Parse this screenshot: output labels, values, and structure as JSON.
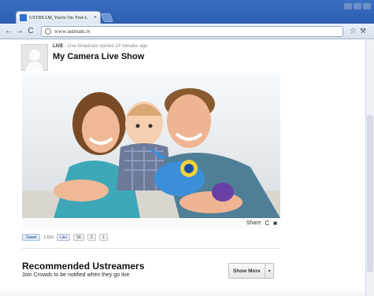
{
  "browser": {
    "tab_title": "USTREAM, You're On. Free L",
    "tab_close": "×",
    "url": "www.ustream.tv",
    "back": "←",
    "forward": "→",
    "reload": "C",
    "star": "☆",
    "wrench": "🔧"
  },
  "broadcast": {
    "live_tag": "LIVE",
    "live_status": " - Live broadcast started 24 minutes ago",
    "title": "My Camera Live Show"
  },
  "player": {
    "share_label": "Share",
    "reload_icon": "C",
    "fullscreen_icon": "■"
  },
  "social": {
    "tweet_label": "Tweet",
    "tweet_count": "1,633",
    "like_label": "Like",
    "like_extra": "3K",
    "misc_label": "Σ",
    "misc_count": "1"
  },
  "recommended": {
    "title": "Recommended Ustreamers",
    "subtitle": "Join Crowds to be notified when they go live",
    "show_more_label": "Show More",
    "caret": "▾"
  },
  "colors": {
    "titlebar": "#3a6fc4",
    "brand_blue": "#2f6fd0"
  }
}
